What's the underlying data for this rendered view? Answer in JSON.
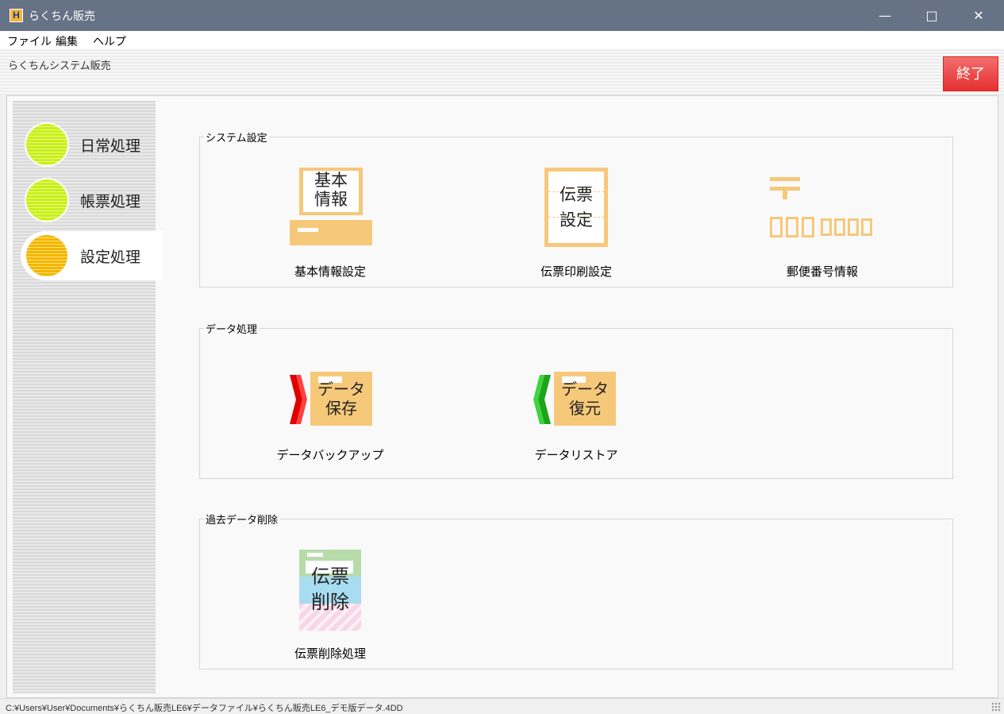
{
  "window": {
    "title": "らくちん販売",
    "icon_letter": "H"
  },
  "menu": [
    "ファイル",
    "編集",
    "ヘルプ"
  ],
  "header": {
    "title": "らくちんシステム販売",
    "exit_label": "終了"
  },
  "sidebar": {
    "items": [
      {
        "label": "日常処理",
        "color": "#c9ef18",
        "active": false
      },
      {
        "label": "帳票処理",
        "color": "#c9ef18",
        "active": false
      },
      {
        "label": "設定処理",
        "color": "#f5b500",
        "active": true
      }
    ]
  },
  "groups": [
    {
      "title": "システム設定",
      "tiles": [
        {
          "label": "基本情報設定",
          "icon": "basic-info-icon",
          "icon_text": [
            "基本",
            "情報"
          ]
        },
        {
          "label": "伝票印刷設定",
          "icon": "slip-setting-icon",
          "icon_text": [
            "伝票",
            "設定"
          ]
        },
        {
          "label": "郵便番号情報",
          "icon": "postal-code-icon",
          "icon_text": [
            "〒"
          ]
        }
      ]
    },
    {
      "title": "データ処理",
      "tiles": [
        {
          "label": "データバックアップ",
          "icon": "data-backup-icon",
          "icon_text": [
            "データ",
            "保存"
          ]
        },
        {
          "label": "データリストア",
          "icon": "data-restore-icon",
          "icon_text": [
            "データ",
            "復元"
          ]
        }
      ]
    },
    {
      "title": "過去データ削除",
      "tiles": [
        {
          "label": "伝票削除処理",
          "icon": "slip-delete-icon",
          "icon_text": [
            "伝票",
            "削除"
          ]
        }
      ]
    }
  ],
  "status": {
    "path": "C:¥Users¥User¥Documents¥らくちん販売LE6¥データファイル¥らくちん販売LE6_デモ版データ.4DD"
  },
  "colors": {
    "titlebar": "#667285",
    "exit": "#e63030",
    "icon_orange": "#f6c87a",
    "arrow_red": "#e00000",
    "arrow_green": "#1aa51a"
  }
}
